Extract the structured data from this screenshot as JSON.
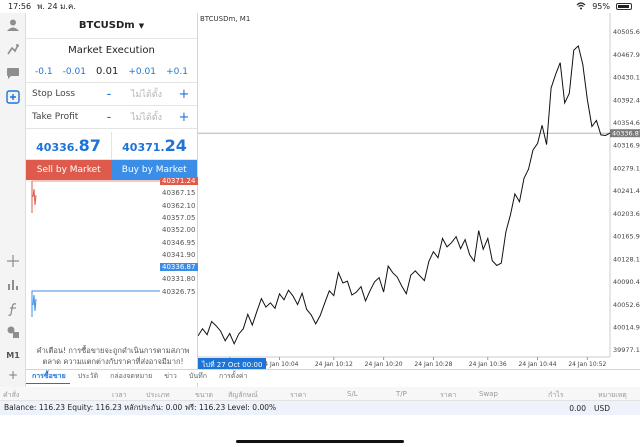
{
  "status_bar": {
    "time": "17:56",
    "date": "พ. 24 ม.ค.",
    "battery": "95%"
  },
  "toolbar": {
    "timeframe": "M1"
  },
  "order": {
    "symbol": "BTCUSDm",
    "caret": "▼",
    "execution": "Market Execution",
    "volume": {
      "minus_big": "-0.1",
      "minus_small": "-0.01",
      "value": "0.01",
      "plus_small": "+0.01",
      "plus_big": "+0.1"
    },
    "stop_loss": {
      "label": "Stop Loss",
      "placeholder": "ไม่ได้ตั้ง",
      "minus": "-",
      "plus": "+"
    },
    "take_profit": {
      "label": "Take Profit",
      "placeholder": "ไม่ได้ตั้ง",
      "minus": "-",
      "plus": "+"
    },
    "bid": {
      "main": "40336.",
      "pips": "87"
    },
    "ask": {
      "main": "40371.",
      "pips": "24"
    },
    "sell_label": "Sell by Market",
    "buy_label": "Buy by Market",
    "mini_ticks": [
      "40371.24",
      "40367.15",
      "40362.10",
      "40357.05",
      "40352.00",
      "40346.95",
      "40341.90",
      "40336.87",
      "40331.80",
      "40326.75"
    ],
    "warning": "คำเตือน! การซื้อขายจะถูกดำเนินการตามสภาพตลาด ความแตกต่างกับราคาที่ส่งอาจมีมาก!"
  },
  "chart": {
    "title": "BTCUSDm, M1",
    "time_badge": "ไปที่ 27 Oct 00:00"
  },
  "chart_data": {
    "type": "line",
    "title": "BTCUSDm, M1",
    "x_ticks": [
      "24 Jan 09:56",
      "24 Jan 10:04",
      "24 Jan 10:12",
      "24 Jan 10:20",
      "24 Jan 10:28",
      "24 Jan 10:36",
      "24 Jan 10:44",
      "24 Jan 10:52"
    ],
    "y_ticks": [
      "40505.65",
      "40467.90",
      "40430.15",
      "40392.40",
      "40354.65",
      "40316.90",
      "40279.15",
      "40241.40",
      "40203.65",
      "40165.90",
      "40128.15",
      "40090.40",
      "40052.65",
      "40014.90",
      "39977.15"
    ],
    "ylim": [
      39965,
      40520
    ],
    "current_price": "40336.87",
    "series": [
      {
        "values": [
          40000,
          40012,
          40002,
          40024,
          40017,
          40008,
          39992,
          40004,
          39987,
          40003,
          40012,
          40036,
          40018,
          40041,
          40062,
          40048,
          40055,
          40046,
          40070,
          40060,
          40076,
          40066,
          40052,
          40071,
          40044,
          40035,
          40020,
          40034,
          40055,
          40075,
          40067,
          40105,
          40088,
          40091,
          40068,
          40073,
          40082,
          40058,
          40075,
          40090,
          40097,
          40073,
          40116,
          40105,
          40098,
          40083,
          40070,
          40101,
          40108,
          40100,
          40092,
          40124,
          40140,
          40130,
          40162,
          40148,
          40155,
          40165,
          40145,
          40160,
          40135,
          40124,
          40175,
          40144,
          40162,
          40125,
          40117,
          40121,
          40173,
          40201,
          40236,
          40223,
          40262,
          40277,
          40309,
          40320,
          40350,
          40318,
          40412,
          40435,
          40454,
          40387,
          40403,
          40475,
          40482,
          40451,
          40392,
          40348,
          40358,
          40334,
          40333,
          40337
        ]
      }
    ]
  },
  "tabs": [
    "การซื้อขาย",
    "ประวัติ",
    "กล่องจดหมาย",
    "ข่าว",
    "บันทึก",
    "การตั้งค่า"
  ],
  "table_headers": [
    "คำสั่ง",
    "เวลา",
    "ประเภท",
    "ขนาด",
    "สัญลักษณ์",
    "ราคา",
    "S/L",
    "T/P",
    "ราคา",
    "Swap",
    "กำไร",
    "หมายเหตุ"
  ],
  "balance": {
    "text": "Balance: 116.23 Equity: 116.23 หลักประกัน: 0.00 ฟรี: 116.23 Level: 0.00%",
    "profit": "0.00",
    "currency": "USD"
  },
  "colors": {
    "accent": "#1e74d6",
    "sell": "#dd5a4c",
    "buy": "#3b8ee8"
  }
}
